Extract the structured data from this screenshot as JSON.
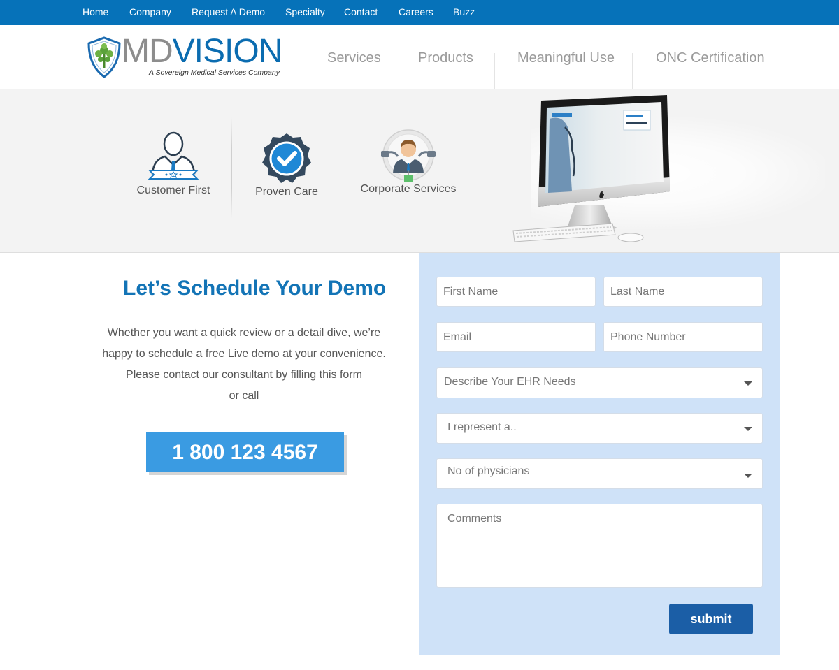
{
  "top_nav": [
    "Home",
    "Company",
    "Request A Demo",
    "Specialty",
    "Contact",
    "Careers",
    "Buzz"
  ],
  "logo": {
    "brand_part1": "MD",
    "brand_part2": "VISION",
    "tagline": "A Sovereign Medical Services Company"
  },
  "main_nav": [
    "Services",
    "Products",
    "Meaningful Use",
    "ONC Certification"
  ],
  "features": [
    {
      "label": "Customer First",
      "icon": "customer-first-icon"
    },
    {
      "label": "Proven Care",
      "icon": "checkmark-badge-icon"
    },
    {
      "label": "Corporate Services",
      "icon": "corporate-person-icon"
    }
  ],
  "demo": {
    "title": "Let’s Schedule Your Demo",
    "lines": [
      "Whether you want a quick review or a detail dive, we’re",
      "happy to schedule a free Live demo at your convenience.",
      "Please contact our consultant by filling this form",
      "or call"
    ],
    "phone": "1 800 123 4567"
  },
  "form": {
    "first_name_placeholder": "First Name",
    "last_name_placeholder": "Last Name",
    "email_placeholder": "Email",
    "phone_placeholder": "Phone Number",
    "ehr_needs": "Describe Your EHR Needs",
    "represent": "I represent a..",
    "physicians": "No of physicians",
    "comments_placeholder": "Comments",
    "submit_label": "submit"
  },
  "colors": {
    "top_bar": "#0672b9",
    "brand_blue": "#1374b6",
    "phone_button": "#3a9be2",
    "form_panel": "#cfe2f8",
    "submit_button": "#1b5ea6"
  }
}
